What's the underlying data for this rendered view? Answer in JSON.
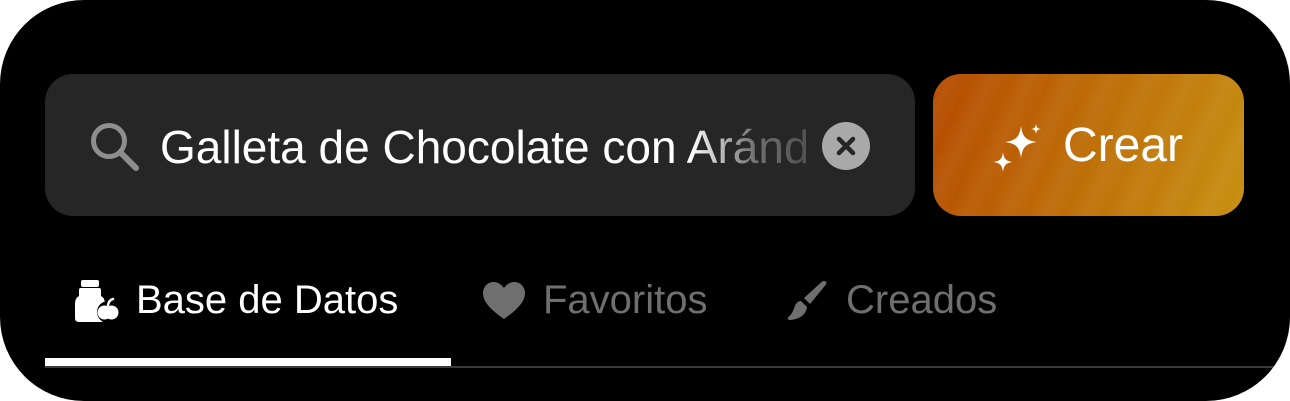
{
  "search": {
    "value": "Galleta de Chocolate con Arándanos",
    "clear_icon": "xmark-circle-icon",
    "search_icon": "magnifying-glass-icon"
  },
  "create": {
    "label": "Crear",
    "icon": "sparkles-icon",
    "color_start": "#b54a00",
    "color_end": "#c79010"
  },
  "tabs": [
    {
      "label": "Base de Datos",
      "icon": "food-database-icon",
      "active": true
    },
    {
      "label": "Favoritos",
      "icon": "heart-icon",
      "active": false
    },
    {
      "label": "Creados",
      "icon": "paintbrush-icon",
      "active": false
    }
  ],
  "colors": {
    "background": "#000000",
    "search_field": "#262626",
    "active_text": "#ffffff",
    "inactive_text": "#6f6f6f"
  }
}
